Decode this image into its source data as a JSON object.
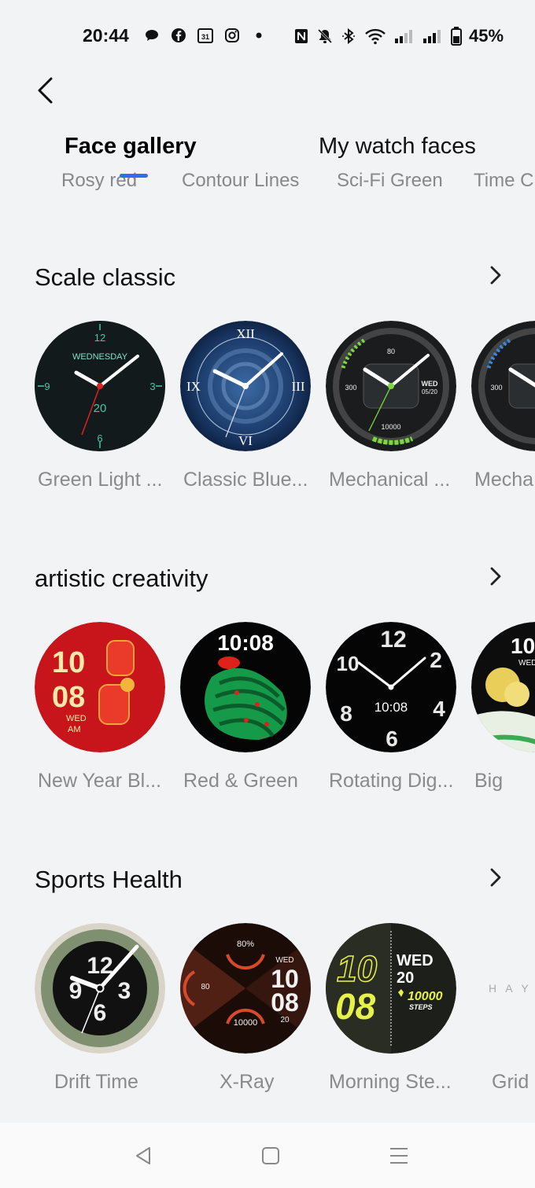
{
  "status_bar": {
    "time": "20:44",
    "battery": "45%",
    "left_icons": [
      "chat-icon",
      "facebook-icon",
      "calendar-icon",
      "instagram-icon",
      "dot-icon"
    ],
    "right_icons": [
      "nfc-icon",
      "mute-icon",
      "bluetooth-icon",
      "wifi-icon",
      "signal-icon",
      "signal-icon",
      "battery-icon"
    ],
    "calendar_day": "31"
  },
  "tabs": [
    {
      "label": "Face gallery",
      "active": true
    },
    {
      "label": "My watch faces",
      "active": false
    }
  ],
  "accent_color": "#2f6ef2",
  "cut_row": [
    "Rosy red",
    "Contour Lines",
    "Sci-Fi Green",
    "Time C"
  ],
  "sections": [
    {
      "title": "Scale classic",
      "faces": [
        {
          "label": "Green Light ...",
          "dial_texts": [
            "WEDNESDAY",
            "12",
            "3",
            "6",
            "9",
            "20"
          ]
        },
        {
          "label": "Classic Blue...",
          "dial_texts": [
            "XII",
            "III",
            "VI",
            "IX"
          ]
        },
        {
          "label": "Mechanical ...",
          "dial_texts": [
            "80",
            "300",
            "WED",
            "05/20",
            "10000"
          ]
        },
        {
          "label": "Mecha",
          "dial_texts": [
            "300"
          ]
        }
      ]
    },
    {
      "title": "artistic creativity",
      "faces": [
        {
          "label": "New Year Bl...",
          "dial_texts": [
            "10",
            "08",
            "WED",
            "AM"
          ]
        },
        {
          "label": "Red & Green",
          "dial_texts": [
            "10:08"
          ]
        },
        {
          "label": "Rotating Dig...",
          "dial_texts": [
            "12",
            "10:08",
            "2",
            "4",
            "6",
            "8",
            "10"
          ]
        },
        {
          "label": "Big",
          "dial_texts": [
            "10",
            "WED"
          ]
        }
      ]
    },
    {
      "title": "Sports Health",
      "faces": [
        {
          "label": "Drift Time",
          "dial_texts": [
            "12",
            "3",
            "6",
            "9"
          ]
        },
        {
          "label": "X-Ray",
          "dial_texts": [
            "80%",
            "80",
            "WED",
            "10",
            "08",
            "20",
            "10000"
          ]
        },
        {
          "label": "Morning Ste...",
          "dial_texts": [
            "10",
            "08",
            "WED",
            "20",
            "10000",
            "STEPS"
          ]
        },
        {
          "label": "Grid",
          "dial_texts": [
            "H A Y"
          ]
        }
      ]
    }
  ]
}
